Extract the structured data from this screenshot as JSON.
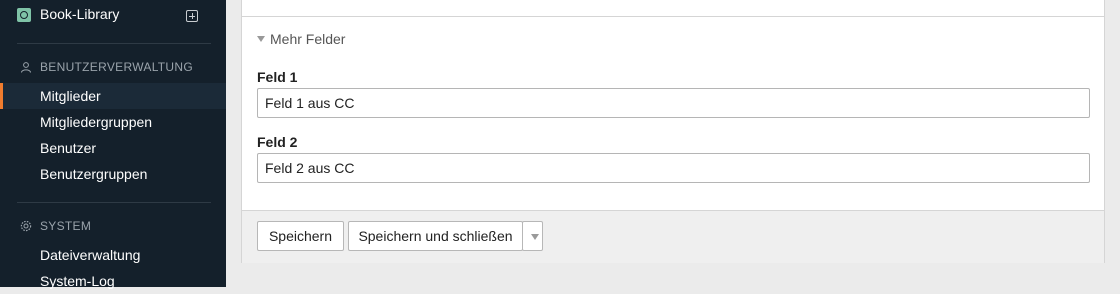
{
  "sidebar": {
    "site": {
      "label": "Book-Library",
      "icon": "site-icon",
      "add_icon": "add-icon"
    },
    "sections": [
      {
        "title": "BENUTZERVERWALTUNG",
        "icon": "user-icon",
        "items": [
          {
            "label": "Mitglieder",
            "active": true
          },
          {
            "label": "Mitgliedergruppen"
          },
          {
            "label": "Benutzer"
          },
          {
            "label": "Benutzergruppen"
          }
        ]
      },
      {
        "title": "SYSTEM",
        "icon": "gear-icon",
        "items": [
          {
            "label": "Dateiverwaltung"
          },
          {
            "label": "System-Log"
          }
        ]
      }
    ]
  },
  "form": {
    "fieldset_label": "Mehr Felder",
    "fields": [
      {
        "label": "Feld 1",
        "value": "Feld 1 aus CC"
      },
      {
        "label": "Feld 2",
        "value": "Feld 2 aus CC"
      }
    ]
  },
  "buttons": {
    "save": "Speichern",
    "save_close": "Speichern und schließen",
    "more_icon": "chevron-down-icon"
  },
  "colors": {
    "sidebar_bg": "#14202b",
    "active_marker": "#f07c2e",
    "site_icon": "#7fc3a7",
    "page_bg": "#ebebeb"
  }
}
